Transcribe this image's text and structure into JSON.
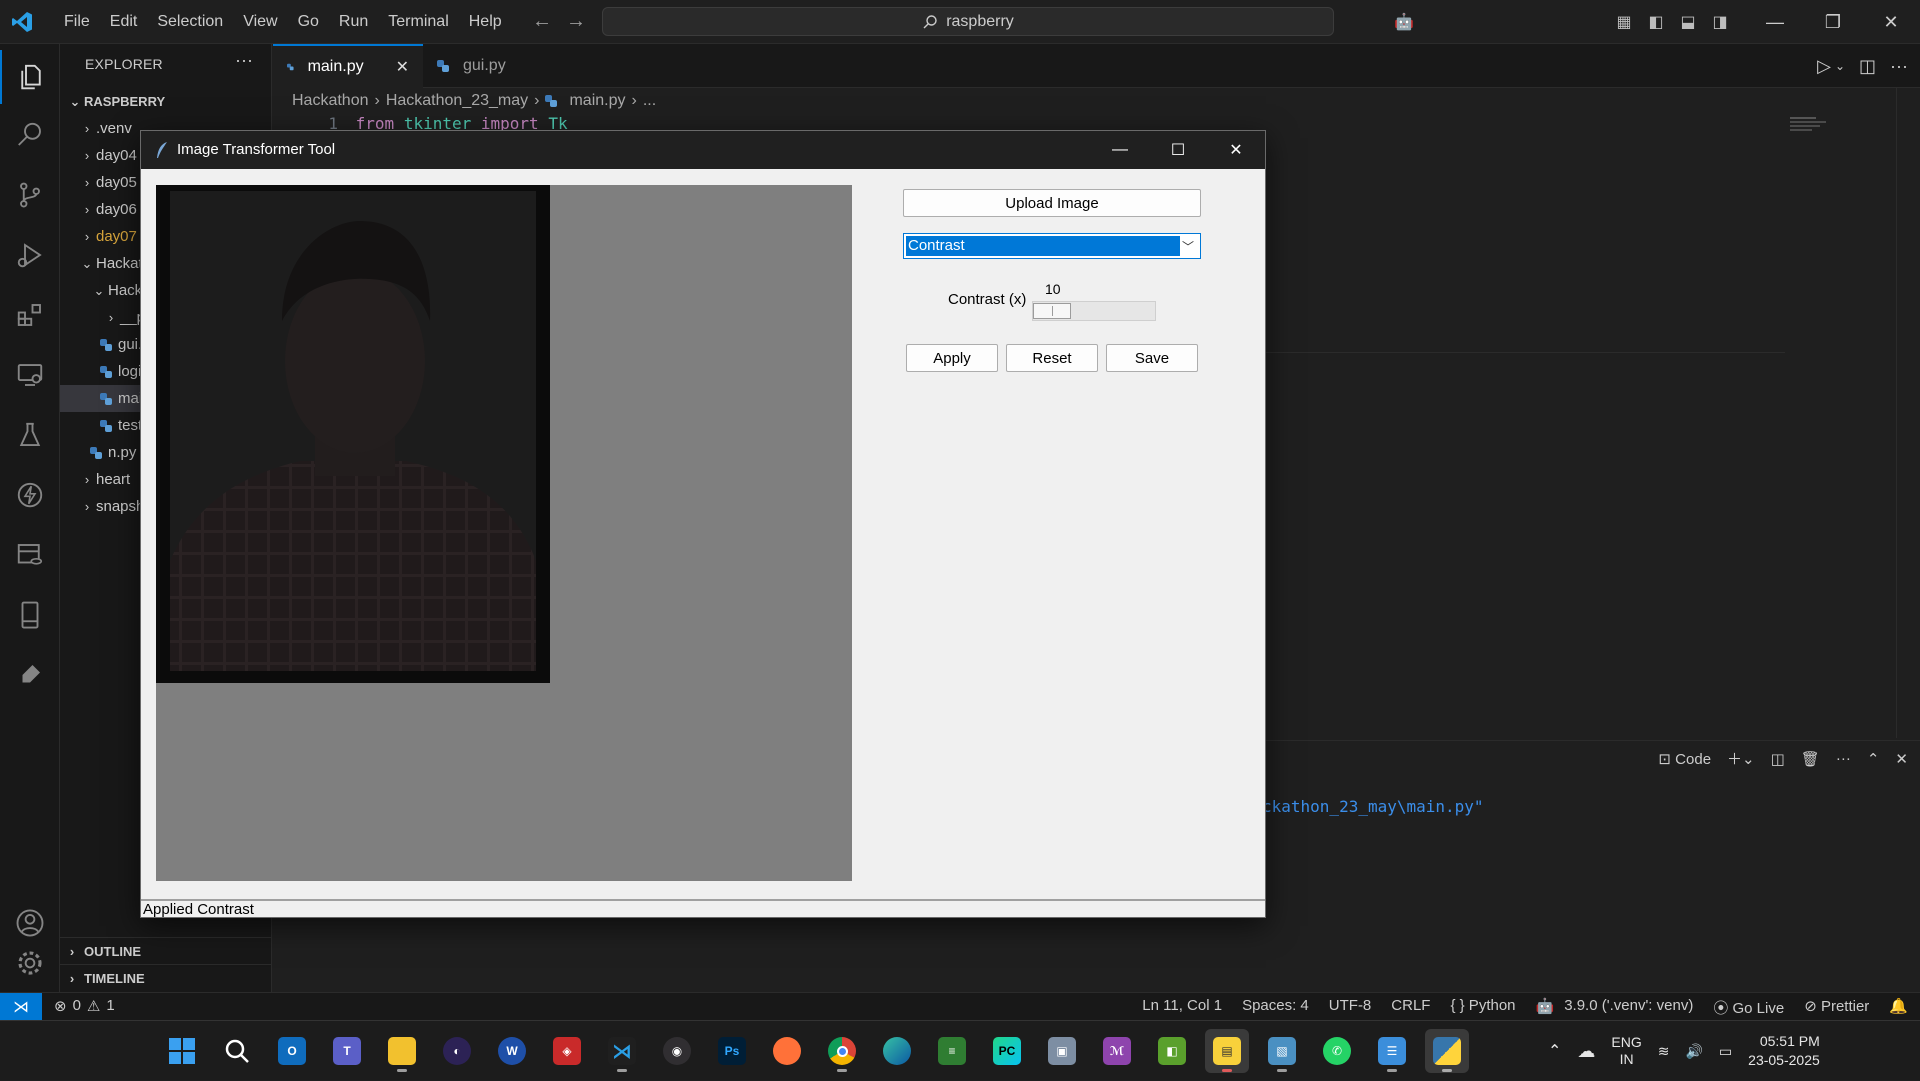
{
  "titlebar": {
    "menu": [
      "File",
      "Edit",
      "Selection",
      "View",
      "Go",
      "Run",
      "Terminal",
      "Help"
    ],
    "search": "raspberry"
  },
  "explorer": {
    "title": "EXPLORER",
    "more": "···",
    "root": "RASPBERRY",
    "items": [
      ".venv",
      "day04",
      "day05",
      "day06",
      "day07",
      "Hackathon",
      "Hackathon_23_may",
      "__pycache__",
      "gui.py",
      "logic.py",
      "main.py",
      "test.py",
      "n.py",
      "heart",
      "snapshots"
    ],
    "outline": "OUTLINE",
    "timeline": "TIMELINE"
  },
  "editor": {
    "tabs": [
      {
        "label": "main.py",
        "active": true
      },
      {
        "label": "gui.py",
        "active": false
      }
    ],
    "breadcrumb": [
      "Hackathon",
      "Hackathon_23_may",
      "main.py",
      "..."
    ],
    "line_number": "1",
    "code": {
      "kw1": "from",
      "mod": "tkinter",
      "kw2": "import",
      "name": "Tk"
    }
  },
  "panel": {
    "terminal_name": "Code",
    "terminal_text": "ckathon_23_may\\main.py\""
  },
  "statusbar": {
    "errors": "0",
    "warnings": "1",
    "position": "Ln 11, Col 1",
    "spaces": "Spaces: 4",
    "encoding": "UTF-8",
    "eol": "CRLF",
    "language": "{ } Python",
    "interpreter": "3.9.0 ('.venv': venv)",
    "golive": "Go Live",
    "prettier": "Prettier"
  },
  "taskbar": {
    "lang1": "ENG",
    "lang2": "IN",
    "time": "05:51 PM",
    "date": "23-05-2025",
    "icons": [
      "windows-start",
      "search",
      "outlook",
      "teams",
      "file-explorer",
      "eclipse",
      "word-app",
      "app-red",
      "vscode",
      "obs",
      "photoshop",
      "firefox",
      "chrome",
      "edge",
      "app-stack",
      "pycharm",
      "app-tool",
      "app-purple",
      "app-green",
      "sticky-notes",
      "app-blue",
      "whatsapp",
      "notepad",
      "python"
    ],
    "accent": "#0078d4"
  },
  "tkapp": {
    "title": "Image Transformer Tool",
    "upload_label": "Upload Image",
    "mode_selected": "Contrast",
    "slider_label": "Contrast (x)",
    "slider_value": "10",
    "apply_label": "Apply",
    "reset_label": "Reset",
    "save_label": "Save",
    "status": "Applied Contrast"
  }
}
